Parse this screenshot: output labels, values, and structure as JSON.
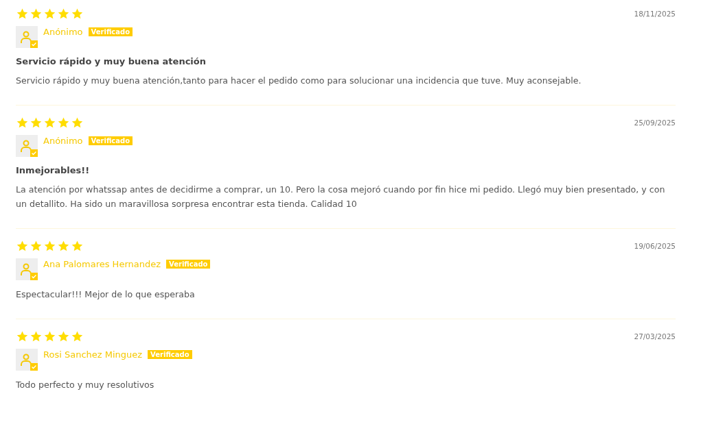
{
  "reviews": [
    {
      "stars": 5,
      "date": "18/11/2025",
      "author": "Anónimo",
      "badge": "Verificado",
      "title": "Servicio rápido y muy buena atención",
      "body": "Servicio rápido y muy buena atención,tanto para hacer el pedido como para solucionar una incidencia que tuve. Muy aconsejable."
    },
    {
      "stars": 5,
      "date": "25/09/2025",
      "author": "Anónimo",
      "badge": "Verificado",
      "title": "Inmejorables!!",
      "body": "La atención por whatssap antes de decidirme a comprar, un 10. Pero la cosa mejoró cuando por fin hice mi pedido. Llegó muy bien presentado, y con un detallito. Ha sido un maravillosa sorpresa encontrar esta tienda. Calidad 10"
    },
    {
      "stars": 5,
      "date": "19/06/2025",
      "author": "Ana Palomares Hernandez",
      "badge": "Verificado",
      "body": "Espectacular!!! Mejor de lo que esperaba"
    },
    {
      "stars": 5,
      "date": "27/03/2025",
      "author": "Rosi Sanchez Minguez",
      "badge": "Verificado",
      "body": "Todo perfecto y muy resolutivos"
    }
  ]
}
